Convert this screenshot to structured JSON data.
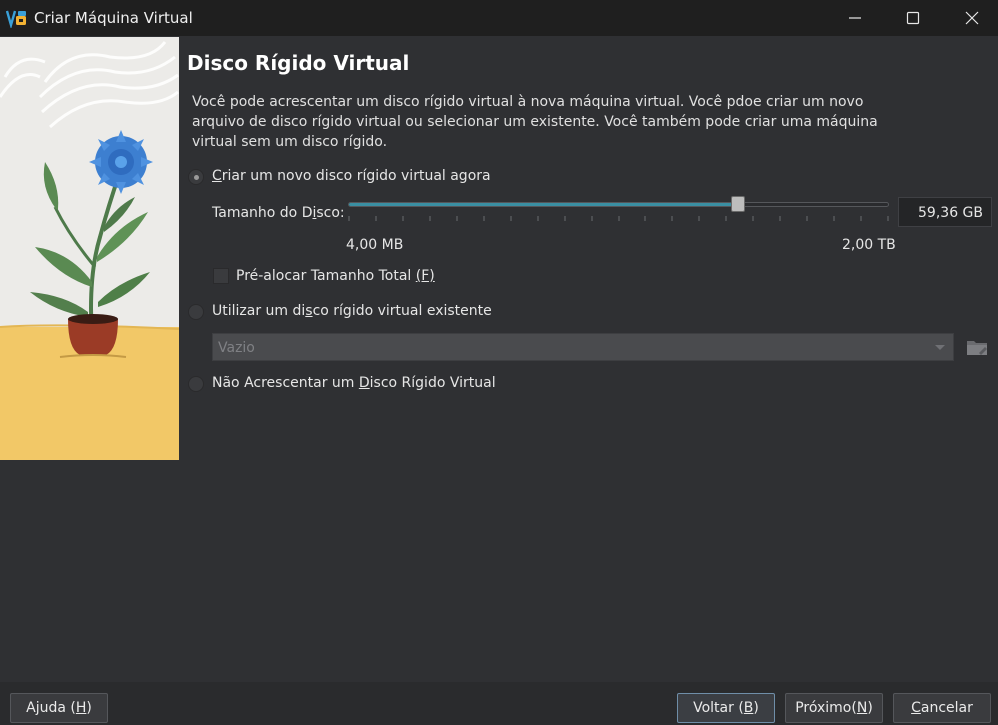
{
  "window": {
    "title": "Criar Máquina Virtual",
    "app_icon": "virtualbox-icon",
    "controls": [
      "minimize-icon",
      "maximize-icon",
      "close-icon"
    ]
  },
  "page": {
    "heading": "Disco Rígido Virtual",
    "description": "Você pode acrescentar um disco rígido virtual à nova máquina virtual. Você pdoe criar um novo arquivo de disco rígido virtual ou selecionar um existente. Você também pode criar uma máquina virtual sem um disco rígido."
  },
  "options": {
    "create_new": {
      "pre": "",
      "mnemonic": "C",
      "post": "riar um novo disco rígido virtual agora",
      "selected": true
    },
    "use_existing": {
      "pre": "Utilizar um di",
      "mnemonic": "s",
      "post": "co rígido virtual existente",
      "selected": false
    },
    "no_disk": {
      "pre": "Não Acrescentar um ",
      "mnemonic": "D",
      "post": "isco Rígido Virtual",
      "selected": false
    }
  },
  "disk_size": {
    "label_pre": "Tamanho do D",
    "label_mnemonic": "i",
    "label_post": "sco:",
    "value": "59,36 GB",
    "min_label": "4,00 MB",
    "max_label": "2,00 TB",
    "slider_fraction": 0.72
  },
  "preallocate": {
    "label_pre": "Pré-alocar Tamanho Total ",
    "label_mnemonic": "(F)",
    "checked": false
  },
  "existing_disk": {
    "selected": "Vazio",
    "folder_icon": "folder-icon"
  },
  "colors": {
    "accent": "#3a8fa3",
    "background": "#2f3033",
    "titlebar": "#1f1f1f"
  },
  "footer": {
    "help": "Ajuda (H)",
    "help_pre": "Ajuda (",
    "help_mn": "H",
    "help_post": ")",
    "back_pre": "Voltar (",
    "back_mn": "B",
    "back_post": ")",
    "next_pre": "Próximo(",
    "next_mn": "N",
    "next_post": ")",
    "cancel_pre": "",
    "cancel_mn": "C",
    "cancel_post": "ancelar"
  }
}
